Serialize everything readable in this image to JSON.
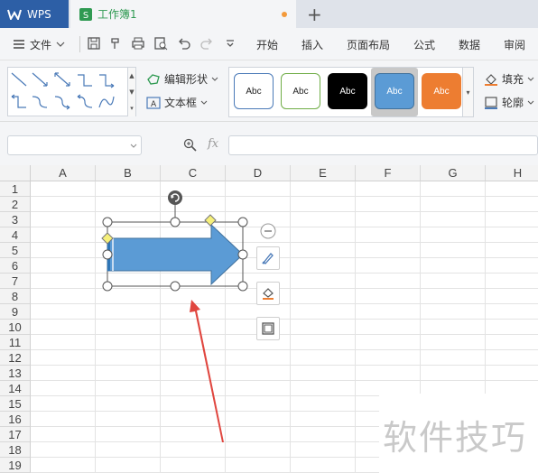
{
  "titlebar": {
    "app_name": "WPS",
    "doc_name": "工作簿1",
    "new_tab": "+"
  },
  "menubar": {
    "file": "文件",
    "tabs": [
      "开始",
      "插入",
      "页面布局",
      "公式",
      "数据",
      "审阅"
    ]
  },
  "ribbon": {
    "edit_shape": "编辑形状",
    "text_box": "文本框",
    "style_label": "Abc",
    "fill": "填充",
    "outline": "轮廓",
    "colors": {
      "style1_border": "#4a7ab8",
      "style2_border": "#70ad47",
      "style3_fill": "#000000",
      "style4_fill": "#5b9bd5",
      "style5_fill": "#ed7d31"
    }
  },
  "formulabar": {
    "fx": "fx"
  },
  "sheet": {
    "columns": [
      "A",
      "B",
      "C",
      "D",
      "E",
      "F",
      "G",
      "H"
    ],
    "rows": [
      "1",
      "2",
      "3",
      "4",
      "5",
      "6",
      "7",
      "8",
      "9",
      "10",
      "11",
      "12",
      "13",
      "14",
      "15",
      "16",
      "17",
      "18",
      "19"
    ]
  },
  "shape": {
    "type": "right-arrow",
    "fill": "#5b9bd5",
    "stroke": "#41719c"
  },
  "annotation_arrow_color": "#e0463f",
  "watermark": "软件技巧"
}
